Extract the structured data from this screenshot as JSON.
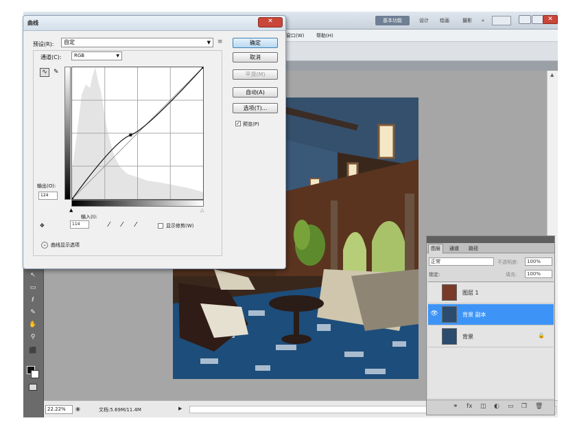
{
  "app": {
    "workspace": {
      "essentials": "基本功能",
      "design": "设计",
      "painting": "绘画",
      "photography": "摄影",
      "more": "»"
    },
    "menu": {
      "window": "窗口(W)",
      "help": "帮助(H)"
    },
    "status": {
      "zoom": "22.22%",
      "doc": "文档:5.69M/11.4M"
    }
  },
  "curves": {
    "title": "曲线",
    "preset_label": "预设(R):",
    "preset_value": "自定",
    "channel_label": "通道(C):",
    "channel_value": "RGB",
    "buttons": {
      "ok": "确定",
      "cancel": "取消",
      "smooth": "平滑(M)",
      "auto": "自动(A)",
      "options": "选项(T)..."
    },
    "preview_label": "预览(P)",
    "output_label": "输出(O):",
    "output_value": "124",
    "input_label": "输入(I):",
    "input_value": "114",
    "clipping_label": "显示修剪(W)",
    "curve_display_label": "曲线显示选项",
    "curve_points": [
      [
        0,
        0
      ],
      [
        114,
        124
      ],
      [
        255,
        255
      ]
    ],
    "histogram_color": "#e4e4e4"
  },
  "layers_panel": {
    "tabs": [
      "图层",
      "通道",
      "路径"
    ],
    "blend_mode": "正常",
    "opacity_label": "不透明度:",
    "opacity_value": "100%",
    "lock_label": "锁定:",
    "fill_label": "填充:",
    "fill_value": "100%",
    "layers": [
      {
        "name": "图层 1",
        "visible": false,
        "selected": false,
        "locked": false
      },
      {
        "name": "背景 副本",
        "visible": true,
        "selected": true,
        "locked": false
      },
      {
        "name": "背景",
        "visible": false,
        "selected": false,
        "locked": true
      }
    ],
    "accent": "#3d94f6"
  }
}
